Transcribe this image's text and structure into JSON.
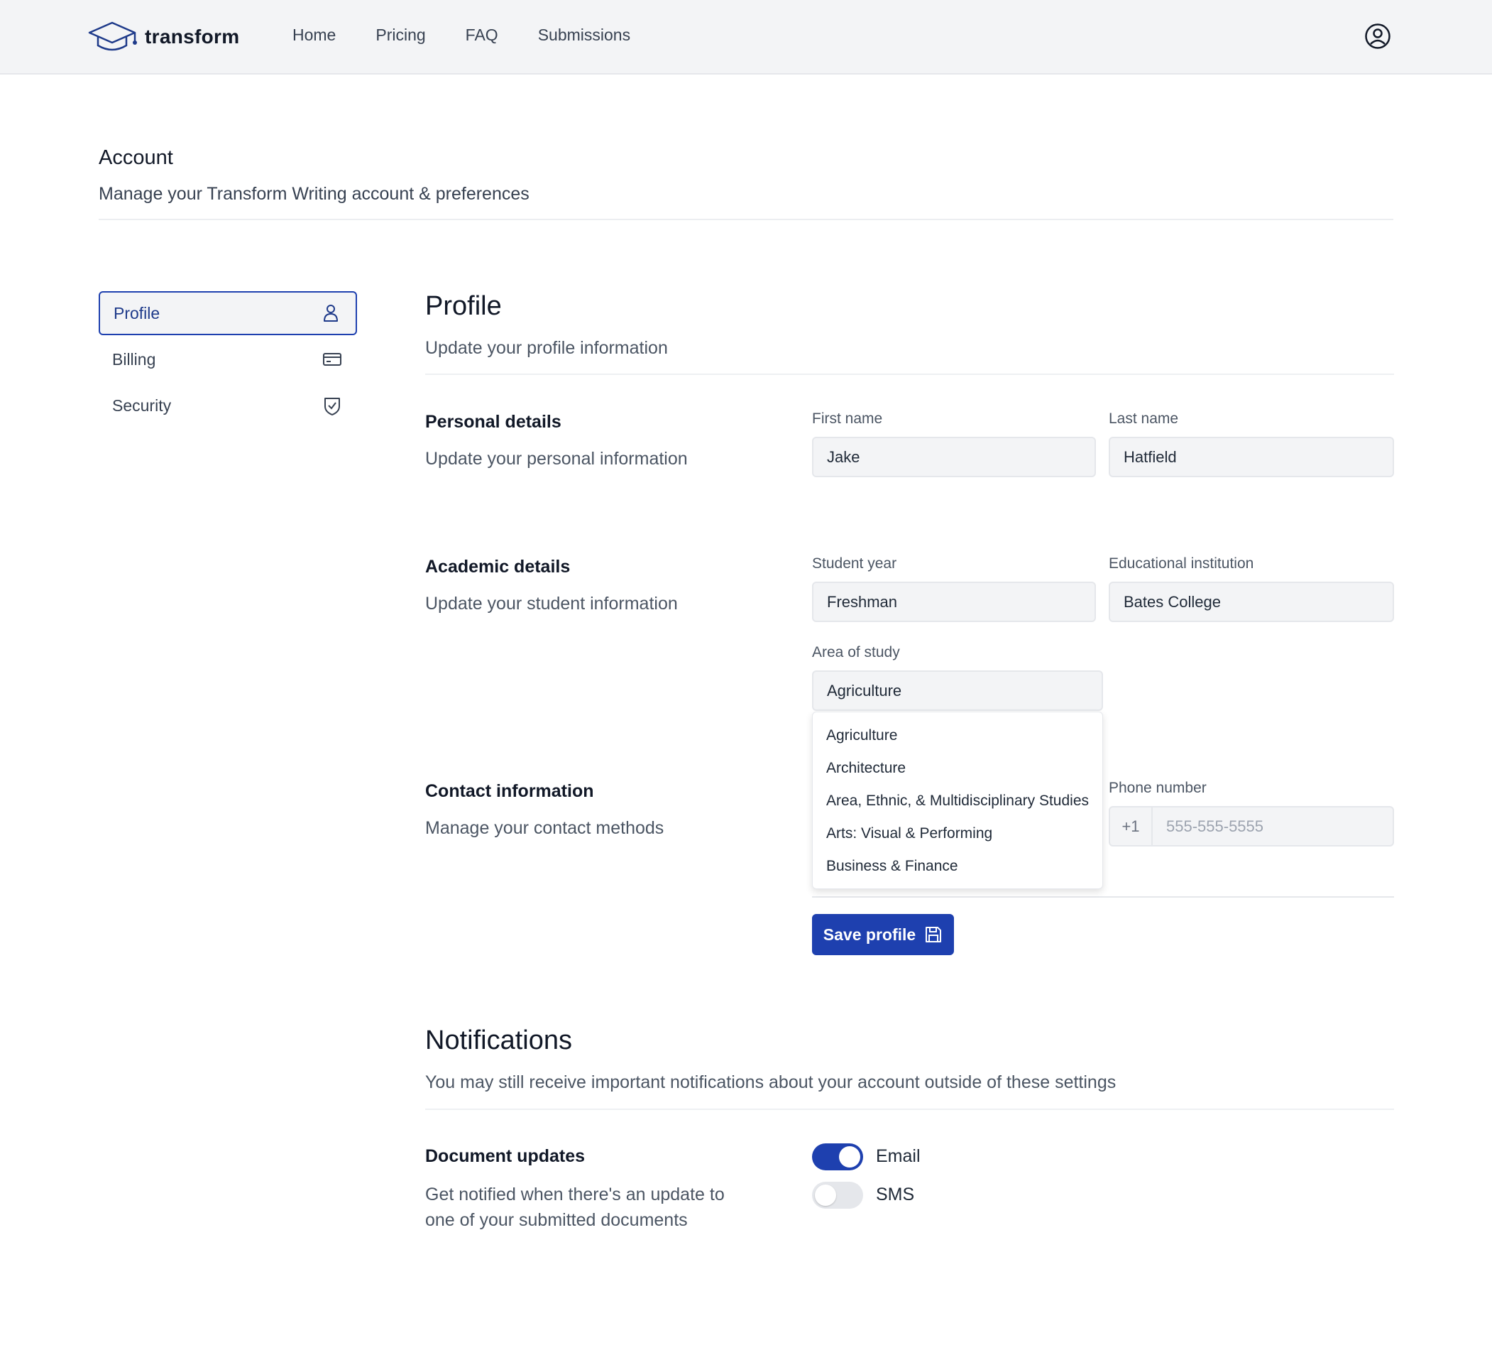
{
  "brand": {
    "name": "transform"
  },
  "nav": {
    "home": "Home",
    "pricing": "Pricing",
    "faq": "FAQ",
    "submissions": "Submissions"
  },
  "account": {
    "title": "Account",
    "subtitle": "Manage your Transform Writing account & preferences"
  },
  "sidebar": {
    "items": [
      {
        "label": "Profile",
        "icon": "user-icon",
        "active": true
      },
      {
        "label": "Billing",
        "icon": "credit-card-icon",
        "active": false
      },
      {
        "label": "Security",
        "icon": "shield-check-icon",
        "active": false
      }
    ]
  },
  "profile": {
    "title": "Profile",
    "subtitle": "Update your profile information",
    "personal": {
      "title": "Personal details",
      "subtitle": "Update your personal information",
      "first_name_label": "First name",
      "first_name_value": "Jake",
      "last_name_label": "Last name",
      "last_name_value": "Hatfield"
    },
    "academic": {
      "title": "Academic details",
      "subtitle": "Update your student information",
      "student_year_label": "Student year",
      "student_year_value": "Freshman",
      "institution_label": "Educational institution",
      "institution_value": "Bates College",
      "area_label": "Area of study",
      "area_value": "Agriculture",
      "area_options": [
        "Agriculture",
        "Architecture",
        "Area, Ethnic, & Multidisciplinary Studies",
        "Arts: Visual & Performing",
        "Business & Finance"
      ]
    },
    "contact": {
      "title": "Contact information",
      "subtitle": "Manage your contact methods",
      "phone_label": "Phone number",
      "phone_prefix": "+1",
      "phone_placeholder": "555-555-5555"
    },
    "save_label": "Save profile"
  },
  "notifications": {
    "title": "Notifications",
    "subtitle": "You may still receive important notifications about your account outside of these settings",
    "document_updates": {
      "title": "Document updates",
      "subtitle": "Get notified when there's an update to one of your submitted documents",
      "email_label": "Email",
      "email_on": true,
      "sms_label": "SMS",
      "sms_on": false
    }
  },
  "colors": {
    "accent": "#1e40af",
    "topbar": "#f3f4f6",
    "input_bg": "#f3f4f6"
  }
}
